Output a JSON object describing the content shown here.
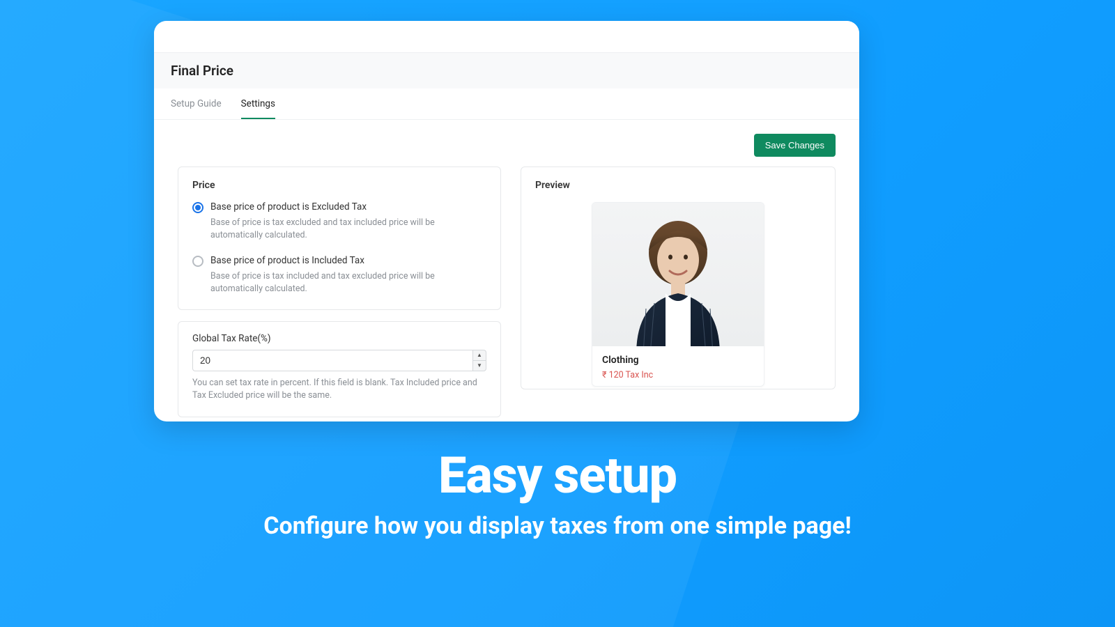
{
  "page_title": "Final Price",
  "tabs": [
    {
      "label": "Setup Guide",
      "active": false
    },
    {
      "label": "Settings",
      "active": true
    }
  ],
  "save_button": "Save Changes",
  "price_section": {
    "heading": "Price",
    "options": [
      {
        "label": "Base price of product is Excluded Tax",
        "description": "Base of price is tax excluded and tax included price will be automatically calculated.",
        "checked": true
      },
      {
        "label": "Base price of product is Included Tax",
        "description": "Base of price is tax included and tax excluded price will be automatically calculated.",
        "checked": false
      }
    ]
  },
  "tax_section": {
    "label": "Global Tax Rate(%)",
    "value": "20",
    "help": "You can set tax rate in percent. If this field is blank. Tax Included price and Tax Excluded price will be the same."
  },
  "preview": {
    "heading": "Preview",
    "product_title": "Clothing",
    "product_price": "₹ 120 Tax Inc"
  },
  "hero": {
    "title": "Easy setup",
    "subtitle": "Configure how you display taxes from one simple page!"
  }
}
